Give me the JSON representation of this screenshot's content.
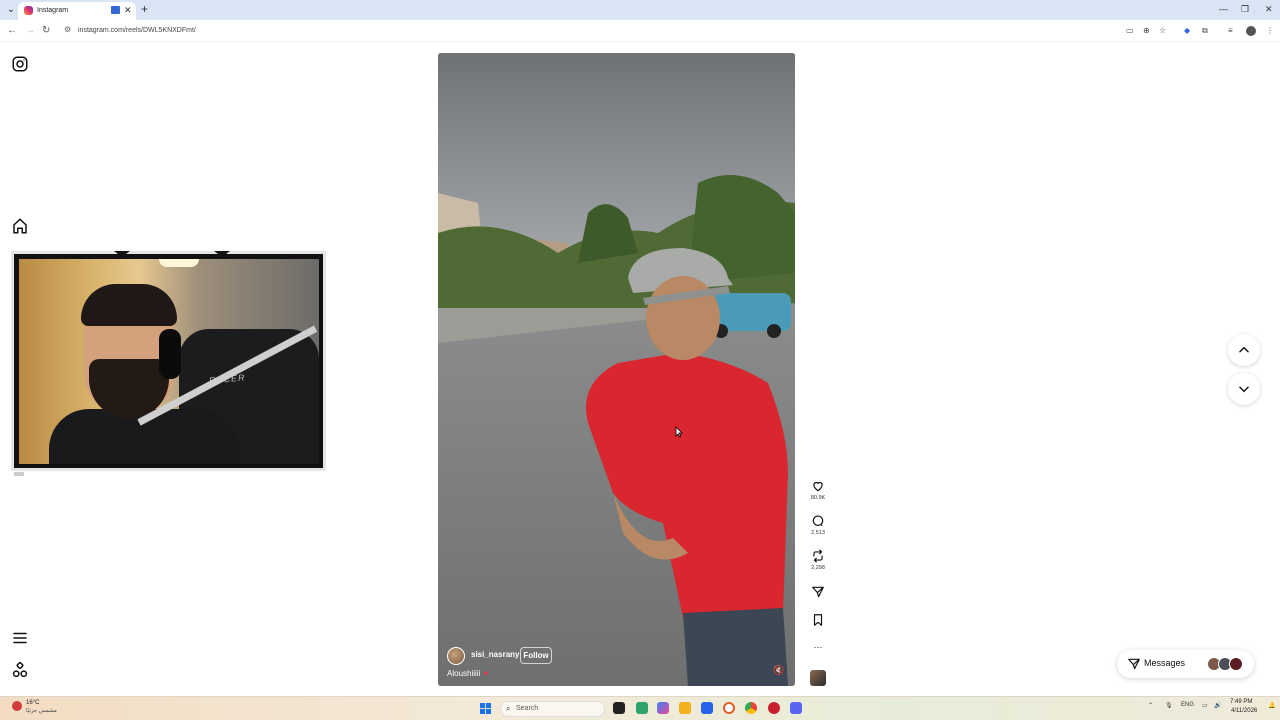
{
  "browser": {
    "tab_title": "Instagram",
    "tab_close": "✕",
    "new_tab": "+",
    "url": "instagram.com/reels/DWL5KNXDFmt/",
    "window_controls": [
      "—",
      "❐",
      "✕"
    ]
  },
  "instagram": {
    "sidebar_icons": [
      "instagram-logo-icon",
      "home-icon",
      "menu-icon",
      "apps-icon"
    ],
    "reel": {
      "author": "sisi_nasrany",
      "follow_label": "Follow",
      "caption": "Aloushiiiii",
      "caption_emoji": "♥"
    },
    "actions": {
      "likes": "80.9K",
      "comments": "2,513",
      "reposts": "2,298",
      "more": "···"
    },
    "messages_label": "Messages"
  },
  "taskbar": {
    "weather_temp": "16°C",
    "weather_desc": "مشمس جزئيًا",
    "search_label": "Search",
    "language": "ENG",
    "time": "7:49 PM",
    "date": "4/11/2026"
  },
  "colors": {
    "instagram_gradient": [
      "#f9a13a",
      "#e1306c",
      "#7a35c5"
    ],
    "shirt_red": "#d9262f",
    "heart_red": "#e5334b"
  }
}
